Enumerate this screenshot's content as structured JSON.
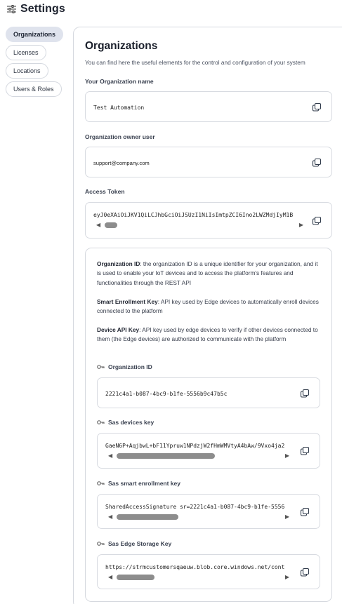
{
  "header": {
    "title": "Settings",
    "icon": "sliders-icon"
  },
  "sidebar": {
    "items": [
      {
        "label": "Organizations",
        "active": true
      },
      {
        "label": "Licenses",
        "active": false
      },
      {
        "label": "Locations",
        "active": false
      },
      {
        "label": "Users & Roles",
        "active": false
      }
    ]
  },
  "main": {
    "title": "Organizations",
    "subtitle": "You can find here the useful elements for the control and configuration of your system",
    "org_name": {
      "label": "Your Organization name",
      "value": "Test Automation"
    },
    "owner": {
      "label": "Organization owner user",
      "value": "support@company.com"
    },
    "token": {
      "label": "Access Token",
      "value": "eyJ0eXAiOiJKV1QiLCJhbGciOiJSUzI1NiIsImtpZCI6Ino2LWZMdjIyM1B"
    },
    "info": {
      "org_id_term": "Organization ID",
      "org_id_desc": ": the organization ID is a unique identifier for your organization, and it is used to enable your IoT devices and to access the platform's features and functionalities through the REST API",
      "enroll_term": "Smart Enrollment Key",
      "enroll_desc": ": API key used by Edge devices to automatically enroll devices connected to the platform",
      "device_term": "Device API Key",
      "device_desc": ": API key used by edge devices to verify if other devices connected to them (the Edge devices) are authorized to communicate with the platform"
    },
    "keys": {
      "org_id": {
        "label": "Organization ID",
        "value": "2221c4a1-b087-4bc9-b1fe-5556b9c47b5c"
      },
      "sas_devices": {
        "label": "Sas devices key",
        "value": "GaeN6P+AqjbwL+bF11Ypruw1NPdzjW2fHmWMVtyA4bAw/9Vxo4ja2"
      },
      "sas_enroll": {
        "label": "Sas smart enrollment key",
        "value": "SharedAccessSignature sr=2221c4a1-b087-4bc9-b1fe-5556"
      },
      "sas_storage": {
        "label": "Sas Edge Storage Key",
        "value": "https://strmcustomersqaeuw.blob.core.windows.net/cont"
      }
    }
  },
  "icons": {
    "copy": "copy-icon",
    "key": "key-icon",
    "scroll_left": "scroll-left-arrow-icon",
    "scroll_right": "scroll-right-arrow-icon"
  }
}
